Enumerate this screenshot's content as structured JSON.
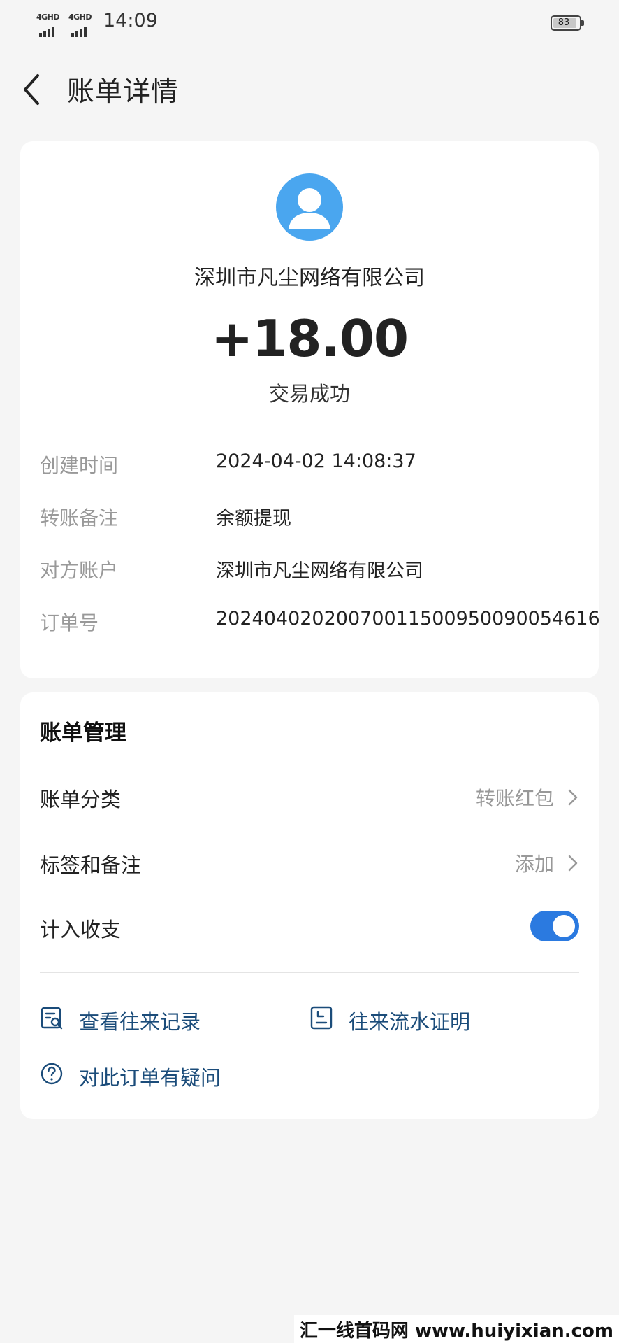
{
  "status_bar": {
    "sim1": "4GHD",
    "sim2": "4GHD",
    "time": "14:09",
    "battery": "83"
  },
  "header": {
    "title": "账单详情"
  },
  "summary": {
    "payee": "深圳市凡尘网络有限公司",
    "amount": "+18.00",
    "status": "交易成功",
    "avatar_color": "#4aa6ef"
  },
  "details": [
    {
      "key": "创建时间",
      "value": "2024-04-02 14:08:37"
    },
    {
      "key": "转账备注",
      "value": "余额提现"
    },
    {
      "key": "对方账户",
      "value": "深圳市凡尘网络有限公司"
    },
    {
      "key": "订单号",
      "value": "20240402020070011500950090054616"
    }
  ],
  "management": {
    "title": "账单管理",
    "category": {
      "label": "账单分类",
      "value": "转账红包"
    },
    "tags": {
      "label": "标签和备注",
      "value": "添加"
    },
    "include": {
      "label": "计入收支",
      "enabled": true
    },
    "links": {
      "records": "查看往来记录",
      "statement": "往来流水证明",
      "question": "对此订单有疑问"
    },
    "accent_color": "#2b7ae0",
    "link_color": "#1b4c7a"
  },
  "watermark": "汇一线首码网 www.huiyixian.com"
}
